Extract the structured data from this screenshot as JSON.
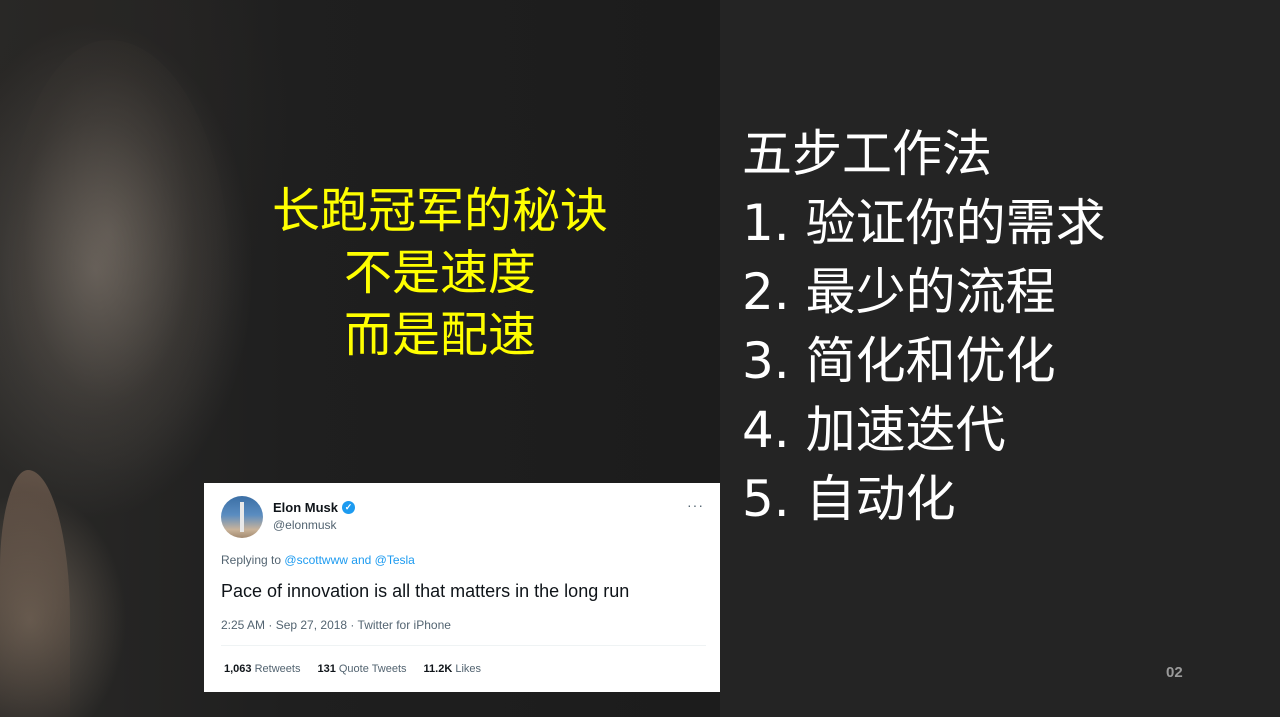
{
  "headline": {
    "lines": [
      "长跑冠军的秘诀",
      "不是速度",
      "而是配速"
    ],
    "color": "#ffff00"
  },
  "steps": {
    "title": "五步工作法",
    "items": [
      "1. 验证你的需求",
      "2. 最少的流程",
      "3. 简化和优化",
      "4. 加速迭代",
      "5. 自动化"
    ]
  },
  "page_number": "02",
  "tweet": {
    "name": "Elon Musk",
    "handle": "@elonmusk",
    "more": "···",
    "replying_prefix": "Replying to",
    "mention_1": "@scottwww",
    "replying_and": "and",
    "mention_2": "@Tesla",
    "text": "Pace of innovation is all that matters in the long run",
    "meta": "2:25 AM · Sep 27, 2018 · Twitter for iPhone",
    "retweets_count": "1,063",
    "retweets_label": "Retweets",
    "quotes_count": "131",
    "quotes_label": "Quote Tweets",
    "likes_count": "11.2K",
    "likes_label": "Likes",
    "accent_color": "#1d9bf0"
  },
  "icons": {
    "verified": "verified-badge-icon",
    "more": "more-options-icon"
  }
}
